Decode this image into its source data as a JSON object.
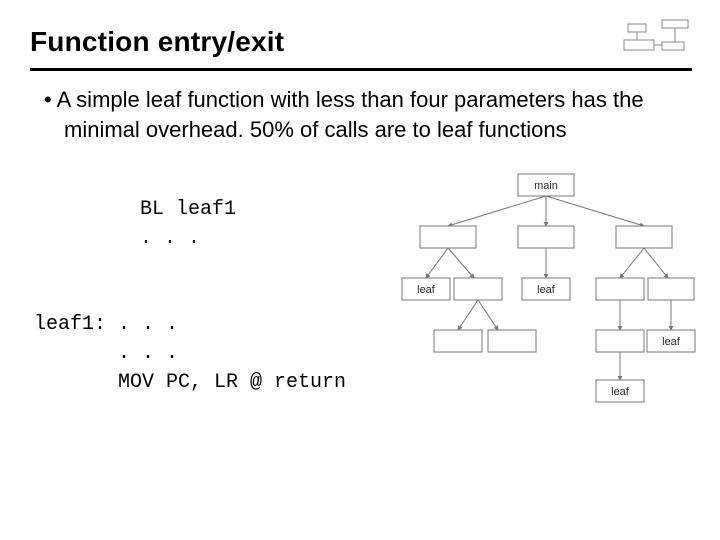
{
  "title": "Function entry/exit",
  "bullet": "A simple leaf function with less than four parameters has the minimal overhead. 50% of calls are to leaf functions",
  "code": {
    "line1": "BL leaf1",
    "line2": ". . .",
    "line3": "leaf1: . . .",
    "line4": "       . . .",
    "line5": "       MOV PC, LR @ return"
  },
  "diagram": {
    "root": "main",
    "leaf_label": "leaf"
  }
}
